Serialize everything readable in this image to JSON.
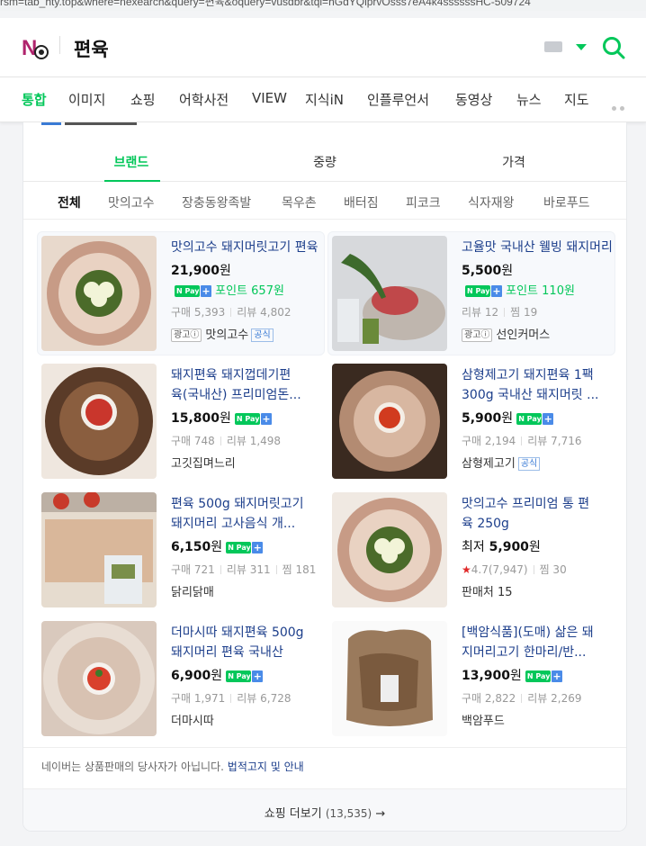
{
  "url_text": "rsm=tab_hty.top&where=nexearch&query=편육&oquery=vusdbr&tqi=hGdYQlprvOsss7eA4k4ssssssHC-509724",
  "search": {
    "query": "편육"
  },
  "tabs": [
    "통합",
    "이미지",
    "쇼핑",
    "어학사전",
    "VIEW",
    "지식iN",
    "인플루언서",
    "동영상",
    "뉴스",
    "지도"
  ],
  "category_tabs": [
    "브랜드",
    "중량",
    "가격"
  ],
  "brands": [
    "전체",
    "맛의고수",
    "장충동왕족발",
    "목우촌",
    "배터짐",
    "피코크",
    "식자재왕",
    "바로푸드"
  ],
  "products": [
    {
      "name": "맛의고수 돼지머릿고기 편육",
      "price": "21,900",
      "currency": "원",
      "point": "포인트 657원",
      "stats": [
        "구매 5,393",
        "리뷰 4,802"
      ],
      "ad": "광고ⓘ",
      "seller": "맛의고수",
      "official": "공식"
    },
    {
      "name": "고율맛 국내산 웰빙 돼지머리",
      "price": "5,500",
      "currency": "원",
      "point": "포인트 110원",
      "stats": [
        "리뷰 12",
        "찜 19"
      ],
      "ad": "광고ⓘ",
      "seller": "선인커머스"
    },
    {
      "name_lines": [
        "돼지편육 돼지껍데기편",
        "육(국내산) 프리미엄돈..."
      ],
      "price": "15,800",
      "currency": "원",
      "stats": [
        "구매 748",
        "리뷰 1,498"
      ],
      "seller": "고깃집며느리"
    },
    {
      "name_lines": [
        "삼형제고기 돼지편육 1팩",
        "300g 국내산 돼지머릿 ..."
      ],
      "price": "5,900",
      "currency": "원",
      "stats": [
        "구매 2,194",
        "리뷰 7,716"
      ],
      "seller": "삼형제고기",
      "official": "공식"
    },
    {
      "name_lines": [
        "편육 500g 돼지머릿고기",
        "돼지머리 고사음식 개..."
      ],
      "price": "6,150",
      "currency": "원",
      "stats": [
        "구매 721",
        "리뷰 311",
        "찜 181"
      ],
      "seller": "닭리닭매"
    },
    {
      "name_lines": [
        "맛의고수 프리미엄 통 편",
        "육 250g"
      ],
      "price_prefix": "최저",
      "price": "5,900",
      "currency": "원",
      "rating": "4.7(7,947)",
      "stats": [
        "찜 30"
      ],
      "seller": "판매처 15"
    },
    {
      "name_lines": [
        "더마시따 돼지편육 500g",
        "돼지머리 편육 국내산"
      ],
      "price": "6,900",
      "currency": "원",
      "stats": [
        "구매 1,971",
        "리뷰 6,728"
      ],
      "seller": "더마시따"
    },
    {
      "name_lines": [
        "[백암식품](도매) 삶은 돼",
        "지머리고기 한마리/반..."
      ],
      "price": "13,900",
      "currency": "원",
      "stats": [
        "구매 2,822",
        "리뷰 2,269"
      ],
      "seller": "백암푸드"
    }
  ],
  "npay_label": "N Pay",
  "notice": {
    "text": "네이버는 상품판매의 당사자가 아닙니다.",
    "link": "법적고지 및 안내"
  },
  "more": {
    "label": "쇼핑 더보기",
    "count": "(13,535)",
    "arrow": "→"
  },
  "colors": {
    "accent": "#03c75a",
    "link": "#1c3e8b",
    "brand_logo": "#b0246d"
  }
}
